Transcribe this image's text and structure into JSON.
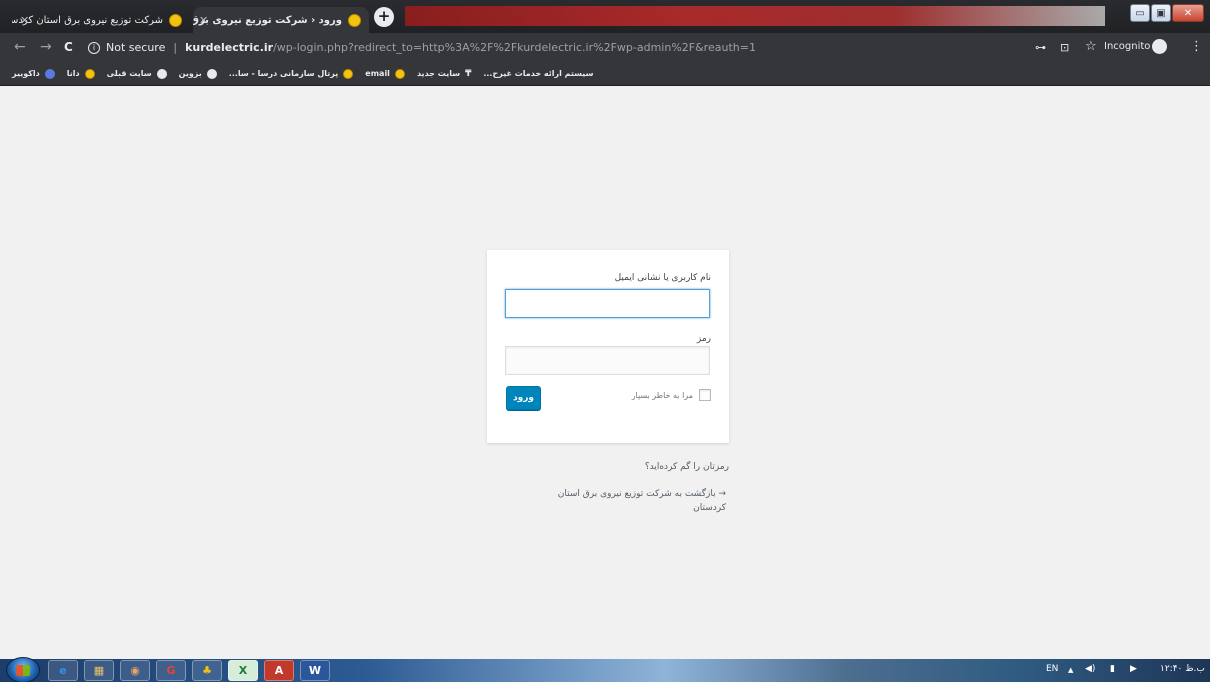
{
  "browser": {
    "tabs": [
      {
        "title": "شرکت توزیع نیروی برق استان کردستان",
        "active": false
      },
      {
        "title": "ورود ‹ شرکت توزیع نیروی برق استان کر",
        "active": true
      }
    ],
    "new_tab_label": "+",
    "window_controls": {
      "minimize": "▭",
      "maximize": "▣",
      "close": "✕"
    },
    "nav": {
      "back": "←",
      "forward": "→",
      "reload": "C"
    },
    "address": {
      "security": "Not secure",
      "domain": "kurdelectric.ir",
      "path": "/wp-login.php?redirect_to=http%3A%2F%2Fkurdelectric.ir%2Fwp-admin%2F&reauth=1"
    },
    "toolbar_right": {
      "key": "⊶",
      "translate": "⊡",
      "star": "☆",
      "incognito": "Incognito",
      "menu": "⋮"
    },
    "bookmarks": [
      {
        "label": "سیستم ارائه خدمات غیرح...",
        "icon": "none"
      },
      {
        "label": "سایت جدید",
        "icon": "ttt-icon"
      },
      {
        "label": "email",
        "icon": "yellow"
      },
      {
        "label": "پرتال سازمانی درسا - سا...",
        "icon": "yellow"
      },
      {
        "label": "بزوین",
        "icon": "globe"
      },
      {
        "label": "سایت قبلی",
        "icon": "globe"
      },
      {
        "label": "دانا",
        "icon": "yellow"
      },
      {
        "label": "داکوییر",
        "icon": "star"
      }
    ]
  },
  "login": {
    "username_label": "نام کاربری یا نشانی ایمیل",
    "username_value": "",
    "password_label": "رمز",
    "password_value": "",
    "remember_label": "مرا به خاطر بسپار",
    "remember_checked": false,
    "submit_label": "ورود",
    "lost_password": "رمزتان را گم کرده‌اید؟",
    "back_link": "→ بازگشت به شرکت توزیع نیروی برق استان کردستان"
  },
  "taskbar": {
    "apps": [
      "e",
      "▦",
      "◉",
      "G",
      "♣",
      "X",
      "A",
      "W"
    ],
    "tray": {
      "lang": "EN",
      "arrow": "▲",
      "volume": "◀)",
      "network": "▮",
      "flag": "▶",
      "clock": "۱۲:۴۰ ب.ظ"
    }
  }
}
